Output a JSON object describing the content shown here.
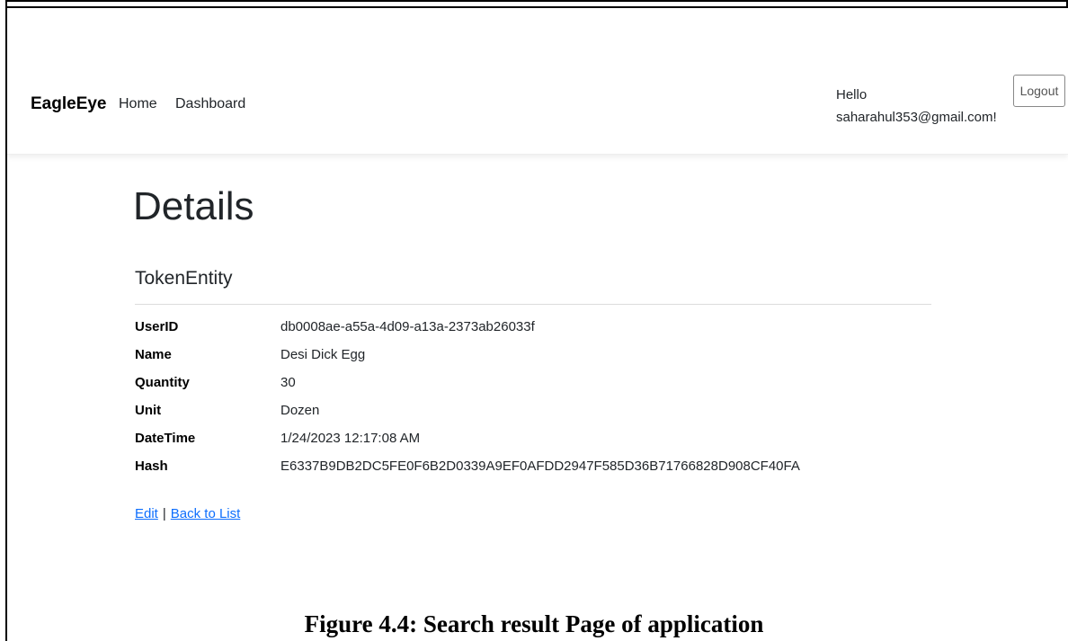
{
  "navbar": {
    "brand": "EagleEye",
    "links": [
      "Home",
      "Dashboard"
    ],
    "greeting_line1": "Hello",
    "greeting_line2": "saharahul353@gmail.com!",
    "logout_label": "Logout"
  },
  "main": {
    "title": "Details",
    "entity": "TokenEntity",
    "fields": [
      {
        "label": "UserID",
        "value": "db0008ae-a55a-4d09-a13a-2373ab26033f"
      },
      {
        "label": "Name",
        "value": "Desi Dick Egg"
      },
      {
        "label": "Quantity",
        "value": "30"
      },
      {
        "label": "Unit",
        "value": "Dozen"
      },
      {
        "label": "DateTime",
        "value": "1/24/2023 12:17:08 AM"
      },
      {
        "label": "Hash",
        "value": "E6337B9DB2DC5FE0F6B2D0339A9EF0AFDD2947F585D36B71766828D908CF40FA"
      }
    ],
    "actions": {
      "edit": "Edit",
      "separator": "|",
      "back": "Back to List"
    }
  },
  "caption": "Figure 4.4: Search result Page of application",
  "colors": {
    "link": "#0d6efd",
    "text": "#212529"
  }
}
